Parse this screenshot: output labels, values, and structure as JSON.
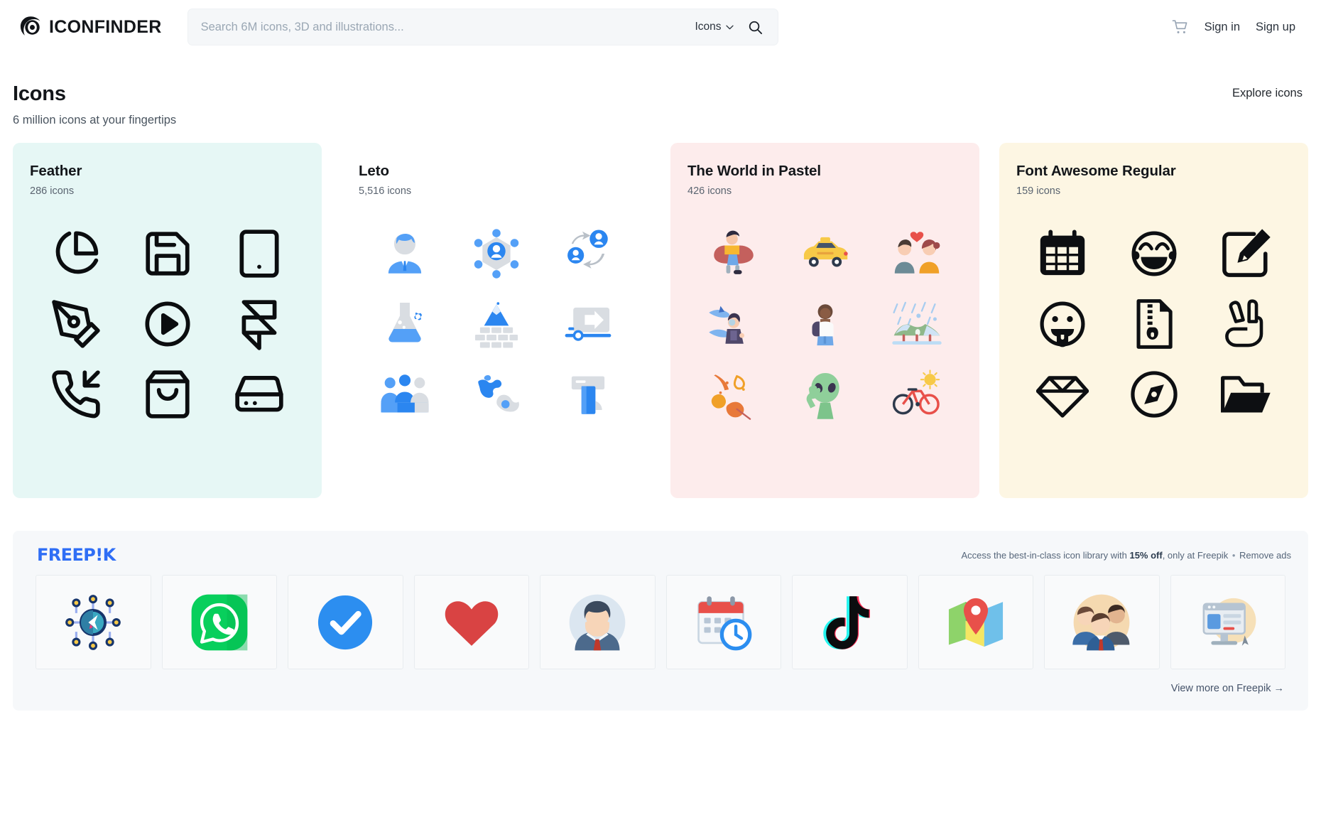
{
  "header": {
    "brand": "ICONFINDER",
    "search": {
      "placeholder": "Search 6M icons, 3D and illustrations...",
      "value": "",
      "scope": "Icons"
    },
    "sign_in": "Sign in",
    "sign_up": "Sign up"
  },
  "page": {
    "title": "Icons",
    "subtitle": "6 million icons at your fingertips",
    "explore": "Explore icons"
  },
  "sets": [
    {
      "title": "Feather",
      "count": "286 icons",
      "bg": "#e6f7f5",
      "style": "outline",
      "icons": [
        "pie-chart-icon",
        "save-icon",
        "tablet-icon",
        "pen-tool-icon",
        "play-circle-icon",
        "framer-icon",
        "phone-incoming-icon",
        "shopping-bag-icon",
        "hard-drive-icon"
      ]
    },
    {
      "title": "Leto",
      "count": "5,516 icons",
      "bg": "#ffffff",
      "style": "flat-blue",
      "icons": [
        "businessman-icon",
        "network-user-icon",
        "user-exchange-icon",
        "flask-gear-icon",
        "firewall-icon",
        "delivery-truck-icon",
        "team-meeting-icon",
        "world-map-icon",
        "atm-card-icon"
      ]
    },
    {
      "title": "The World in Pastel",
      "count": "426 icons",
      "bg": "#fdecec",
      "style": "illustration",
      "icons": [
        "reading-person-icon",
        "taxi-icon",
        "couple-in-love-icon",
        "diver-sharks-icon",
        "backpacker-icon",
        "rainy-hills-icon",
        "autumn-leaves-icon",
        "alien-icon",
        "bicycle-sun-icon"
      ]
    },
    {
      "title": "Font Awesome Regular",
      "count": "159 icons",
      "bg": "#fdf6e3",
      "style": "solid-black",
      "icons": [
        "calendar-icon",
        "grin-beam-icon",
        "pen-square-icon",
        "grin-tongue-icon",
        "file-archive-icon",
        "hand-peace-icon",
        "gem-icon",
        "compass-icon",
        "folder-open-icon"
      ]
    }
  ],
  "ad": {
    "logo": "FREEP!K",
    "note_prefix": "Access the best-in-class icon library with ",
    "note_bold": "15% off",
    "note_suffix": ", only at Freepik",
    "separator": "•",
    "remove_ads": "Remove ads",
    "footer_link": "View more on Freepik →",
    "tiles": [
      "digital-marketing-icon",
      "whatsapp-icon",
      "check-circle-icon",
      "heart-icon",
      "businessman-avatar-icon",
      "calendar-clock-icon",
      "tiktok-icon",
      "map-pin-icon",
      "business-team-icon",
      "web-design-icon"
    ]
  }
}
